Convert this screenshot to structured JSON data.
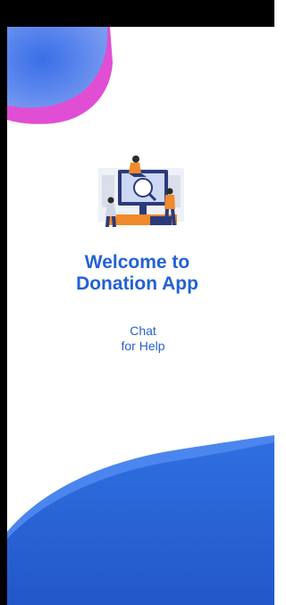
{
  "welcome": {
    "line1": "Welcome to",
    "line2": "Donation App"
  },
  "chat": {
    "line1": "Chat",
    "line2": "for Help"
  },
  "colors": {
    "primary_blue": "#2361d6",
    "wave_blue": "#2f6fe0",
    "blob_pink": "#e24fd0",
    "blob_blue": "#3f76e8"
  },
  "icons": {
    "illustration": "people-at-computer-illustration"
  }
}
